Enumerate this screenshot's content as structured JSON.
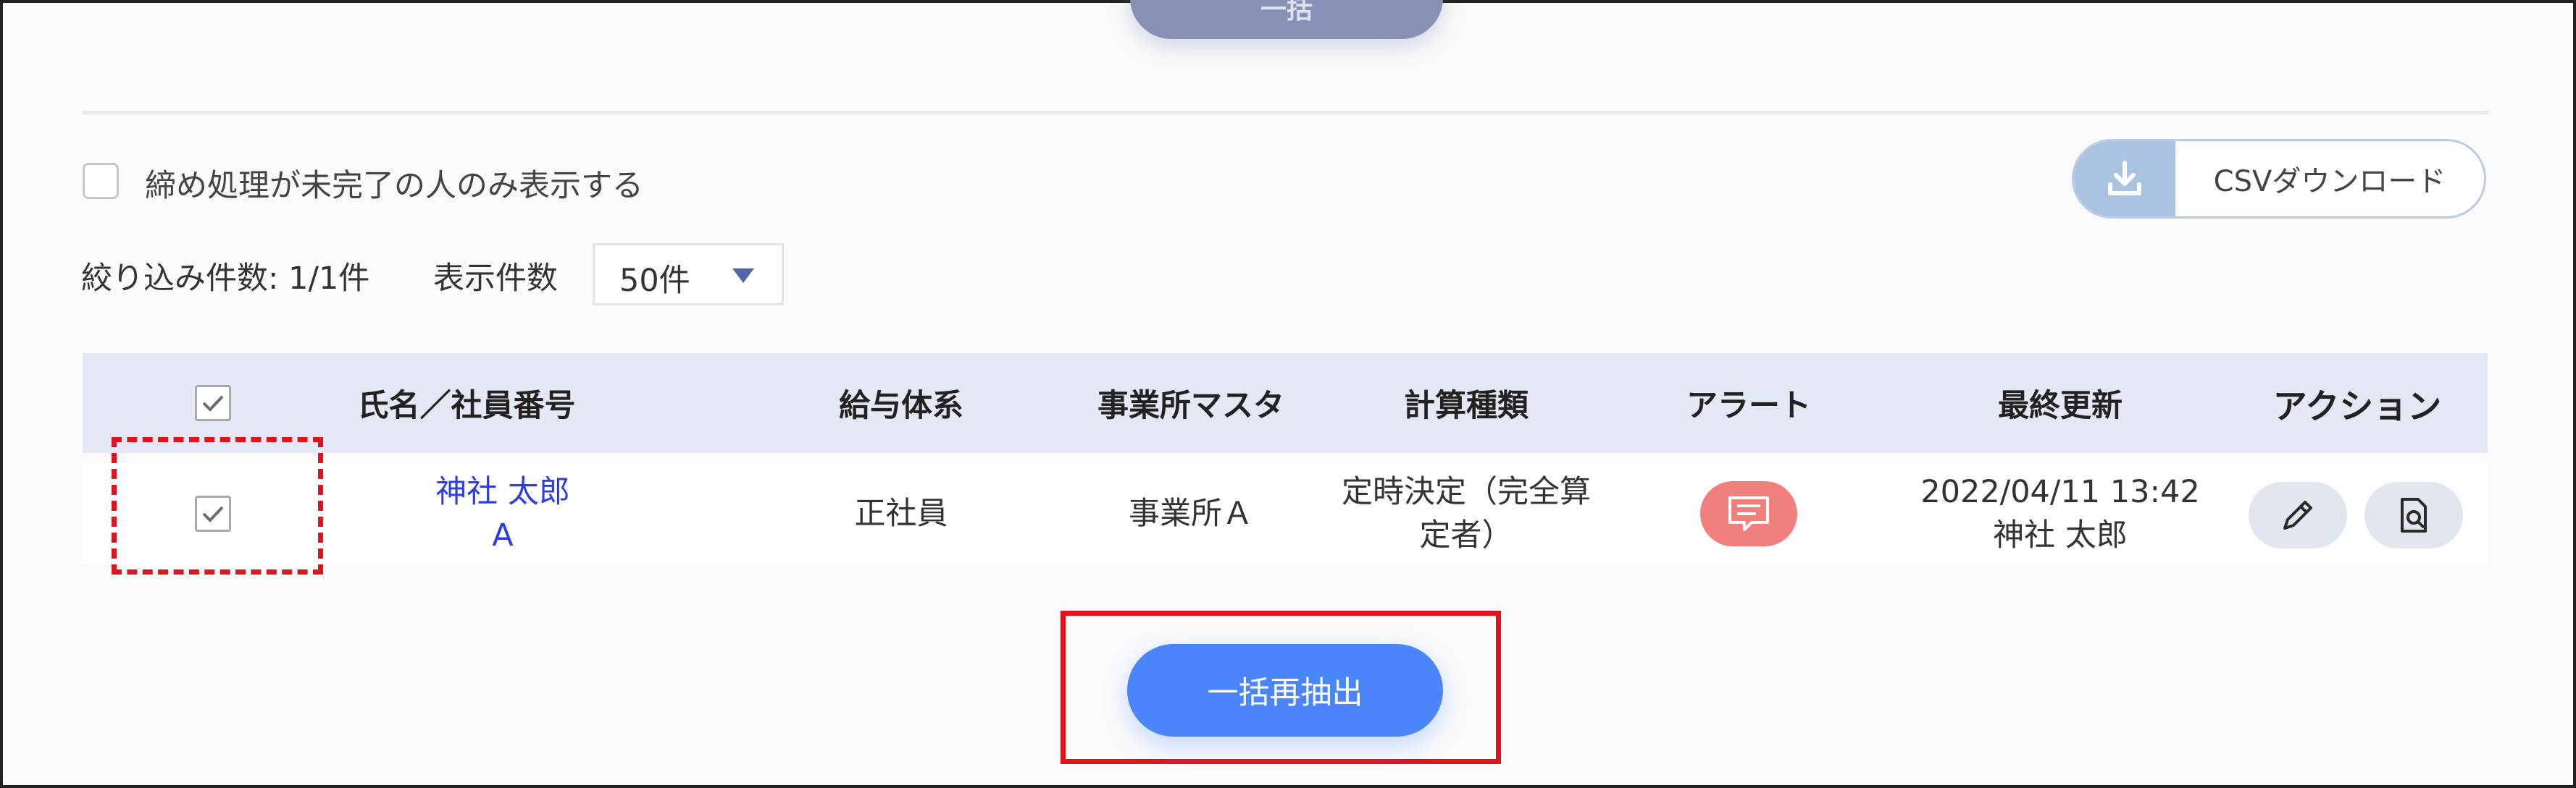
{
  "top_button": {
    "label": "一括"
  },
  "filter": {
    "checkbox_label": "締め処理が未完了の人のみ表示する",
    "checked": false
  },
  "csv_button": {
    "label": "CSVダウンロード"
  },
  "filter_count": {
    "label": "絞り込み件数: 1/1件"
  },
  "per_page": {
    "label": "表示件数",
    "value": "50件"
  },
  "table": {
    "headers": {
      "name": "氏名／社員番号",
      "pay_system": "給与体系",
      "office": "事業所マスタ",
      "calc_type": "計算種類",
      "alert": "アラート",
      "last_updated": "最終更新",
      "action": "アクション"
    },
    "rows": [
      {
        "checked": true,
        "name": "神社 太郎",
        "employee_no": "A",
        "pay_system": "正社員",
        "office": "事業所Ａ",
        "calc_type_line1": "定時決定（完全算",
        "calc_type_line2": "定者）",
        "last_updated_date": "2022/04/11 13:42",
        "last_updated_by": "神社 太郎"
      }
    ]
  },
  "reextract_button": {
    "label": "一括再抽出"
  },
  "colors": {
    "primary": "#4b85fb",
    "alert": "#f07f7d",
    "header_bg": "#e4e8f4",
    "link": "#2b3ee6",
    "annotation": "#e0141b"
  },
  "icons": {
    "download": "download-icon",
    "caret": "caret-down-icon",
    "check": "check-icon",
    "alert": "message-icon",
    "edit": "pencil-icon",
    "detail": "document-search-icon"
  }
}
